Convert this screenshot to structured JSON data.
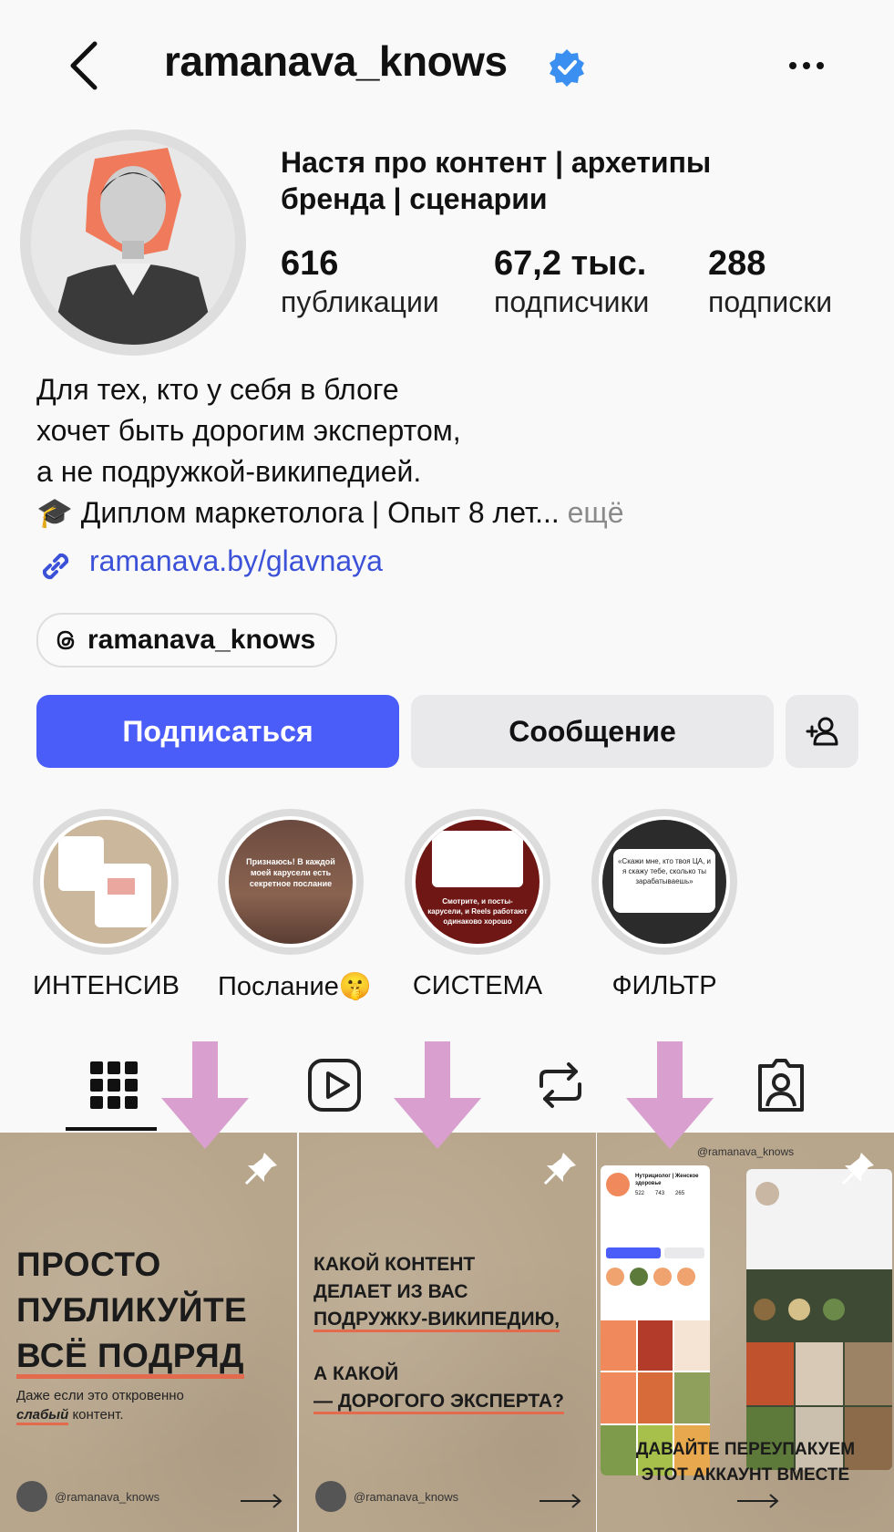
{
  "header": {
    "username": "ramanava_knows",
    "back_icon": "chevron-left-icon",
    "verified_icon": "verified-badge-icon",
    "more_icon": "more-horizontal-icon"
  },
  "profile": {
    "full_name": "Настя про контент | архетипы бренда | сценарии",
    "stats": [
      {
        "value": "616",
        "label": "публикации"
      },
      {
        "value": "67,2 тыс.",
        "label": "подписчики"
      },
      {
        "value": "288",
        "label": "подписки"
      }
    ],
    "bio_lines": [
      "Для тех, кто у себя в блоге",
      "хочет быть дорогим экспертом,",
      "а не подружкой-википедией.",
      "🎓 Диплом маркетолога | Опыт 8 лет..."
    ],
    "bio_more": "ещё",
    "link": "ramanava.by/glavnaya",
    "threads_handle": "ramanava_knows"
  },
  "actions": {
    "follow": "Подписаться",
    "message": "Сообщение",
    "add_user_icon": "add-user-icon"
  },
  "highlights": [
    {
      "label": "ИНТЕНСИВ"
    },
    {
      "label": "Послание🤫",
      "text": "Признаюсь! В каждой моей карусели есть секретное послание"
    },
    {
      "label": "СИСТЕМА",
      "text": "Смотрите, и посты-карусели, и Reels работают одинаково хорошо"
    },
    {
      "label": "ФИЛЬТР",
      "text": "«Скажи мне, кто твоя ЦА, и я скажу тебе, сколько ты зарабатываешь»"
    }
  ],
  "tabs": [
    "grid-icon",
    "reels-icon",
    "reposts-icon",
    "tagged-icon"
  ],
  "posts": [
    {
      "title_lines": [
        "ПРОСТО",
        "ПУБЛИКУЙТЕ",
        "ВСЁ ПОДРЯД"
      ],
      "subtitle_pre": "Даже если это откровенно",
      "subtitle_em": "слабый",
      "subtitle_post": " контент.",
      "handle": "@ramanava_knows"
    },
    {
      "title_lines": [
        "КАКОЙ КОНТЕНТ",
        "ДЕЛАЕТ ИЗ ВАС",
        "ПОДРУЖКУ-ВИКИПЕДИЮ,",
        "",
        "А КАКОЙ",
        "— ДОРОГОГО ЭКСПЕРТА?"
      ],
      "handle": "@ramanava_knows"
    },
    {
      "handle": "@ramanava_knows",
      "mini_title": "Нутрициолог | Женское здоровье",
      "mini_stats": [
        "522",
        "743",
        "265"
      ],
      "title_lines": [
        "ДАВАЙТЕ ПЕРЕУПАКУЕМ",
        "ЭТОТ АККАУНТ ВМЕСТЕ"
      ]
    }
  ],
  "colors": {
    "accent": "#4a5df9",
    "link": "#3b51d8",
    "arrow": "#d9a0cf",
    "underline": "#e36a4c"
  }
}
